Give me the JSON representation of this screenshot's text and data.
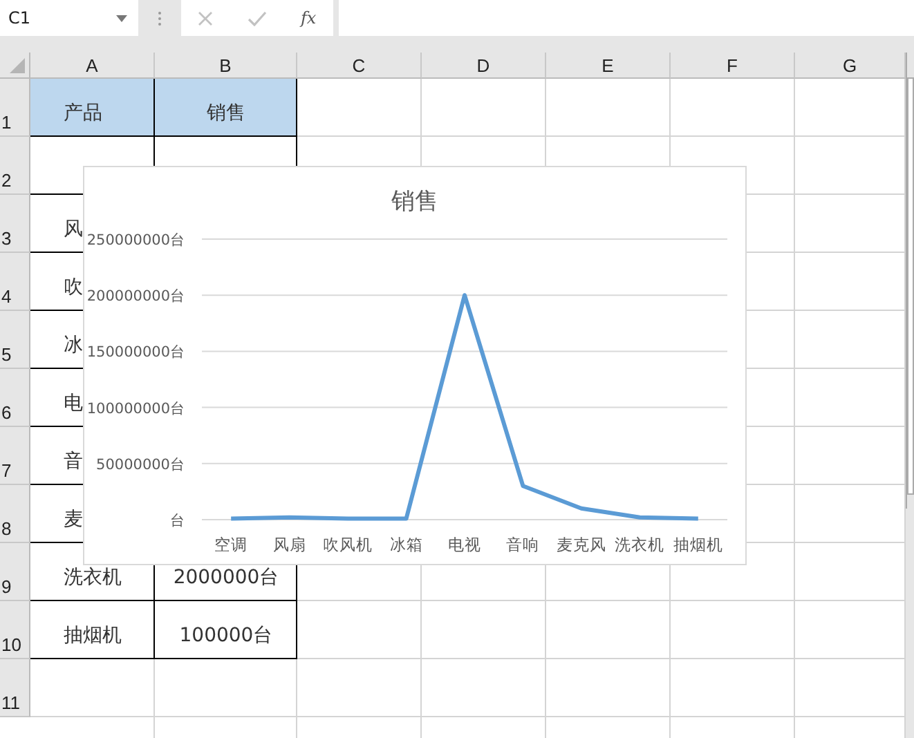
{
  "name_box": {
    "value": "C1"
  },
  "formula_bar": {
    "function_label": "fx"
  },
  "sheet": {
    "columns": [
      "A",
      "B",
      "C",
      "D",
      "E",
      "F",
      "G"
    ],
    "rows": [
      {
        "number": "1",
        "cells": [
          {
            "text": "产品",
            "highlighted": true
          },
          {
            "text": "销售",
            "highlighted": true
          }
        ]
      },
      {
        "number": "2"
      },
      {
        "number": "3",
        "cells": [
          {
            "text": "风",
            "highlighted": false
          }
        ]
      },
      {
        "number": "4",
        "cells": [
          {
            "text": "吹",
            "highlighted": false
          }
        ]
      },
      {
        "number": "5",
        "cells": [
          {
            "text": "冰",
            "highlighted": false
          }
        ]
      },
      {
        "number": "6",
        "cells": [
          {
            "text": "电",
            "highlighted": false
          }
        ]
      },
      {
        "number": "7",
        "cells": [
          {
            "text": "音",
            "highlighted": false
          }
        ]
      },
      {
        "number": "8",
        "cells": [
          {
            "text": "麦",
            "highlighted": false
          }
        ]
      },
      {
        "number": "9",
        "cells": [
          {
            "text": "洗衣机",
            "highlighted": false
          },
          {
            "text": "2000000台",
            "highlighted": false
          }
        ]
      },
      {
        "number": "10",
        "cells": [
          {
            "text": "抽烟机",
            "highlighted": false
          },
          {
            "text": "100000台",
            "highlighted": false
          }
        ]
      },
      {
        "number": "11"
      }
    ]
  },
  "chart": {
    "chart_data": {
      "type": "line",
      "title": "销售",
      "categories": [
        "空调",
        "风扇",
        "吹风机",
        "冰箱",
        "电视",
        "音响",
        "麦克风",
        "洗衣机",
        "抽烟机"
      ],
      "series": [
        {
          "color": "#5b9bd5",
          "values": [
            1000000,
            2000000,
            1000000,
            1000000,
            200000000,
            30000000,
            10000000,
            2000000,
            1000000
          ]
        }
      ],
      "grid": true,
      "ylim": [
        0,
        250000000
      ],
      "yticks": [
        {
          "value": 0,
          "label": "台"
        },
        {
          "value": 50000000,
          "label": "50000000台"
        },
        {
          "value": 100000000,
          "label": "100000000台"
        },
        {
          "value": 150000000,
          "label": "150000000台"
        },
        {
          "value": 200000000,
          "label": "200000000台"
        },
        {
          "value": 250000000,
          "label": "250000000台"
        }
      ]
    }
  }
}
